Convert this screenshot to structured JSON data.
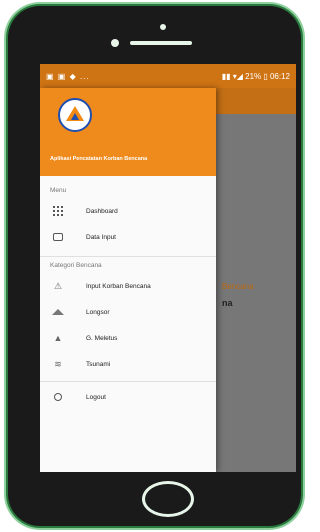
{
  "status_bar": {
    "left": "▣ ▣ ◆ ...",
    "right": "▮▮ ▾◢ 21% ▯ 06:12"
  },
  "behind": {
    "line1": "Bencana",
    "line2": "na"
  },
  "drawer": {
    "app_name": "Aplikasi Pencatatan Korban Bencana",
    "section_menu": "Menu",
    "menu_items": [
      {
        "label": "Dashboard",
        "icon": "grid-icon"
      },
      {
        "label": "Data Input",
        "icon": "tray-icon"
      }
    ],
    "section_kategori": "Kategori Bencana",
    "kategori_items": [
      {
        "label": "Input Korban Bencana",
        "icon": "disaster-icon"
      },
      {
        "label": "Longsor",
        "icon": "landslide-icon"
      },
      {
        "label": "G. Meletus",
        "icon": "volcano-icon"
      },
      {
        "label": "Tsunami",
        "icon": "wave-icon"
      }
    ],
    "logout_label": "Logout"
  },
  "colors": {
    "accent": "#ef8a1c",
    "status": "#cf7414",
    "logo_blue": "#1f4fb0"
  }
}
